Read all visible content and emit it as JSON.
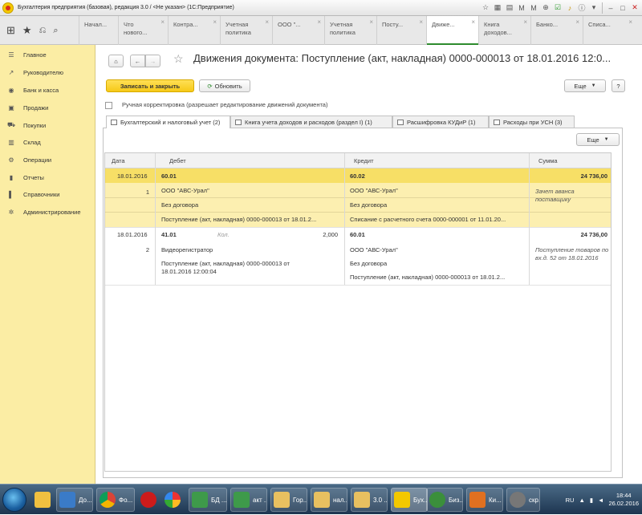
{
  "window": {
    "title": "Бухгалтерия предприятия (базовая), редакция 3.0 / <Не указан> (1С:Предприятие)"
  },
  "tabs": [
    {
      "label": "Начал..."
    },
    {
      "label": "Что нового..."
    },
    {
      "label": "Контра..."
    },
    {
      "label": "Учетная политика"
    },
    {
      "label": "ООО \"..."
    },
    {
      "label": "Учетная политика"
    },
    {
      "label": "Посту..."
    },
    {
      "label": "Движе..."
    },
    {
      "label": "Книга доходов..."
    },
    {
      "label": "Банко..."
    },
    {
      "label": "Списа..."
    }
  ],
  "sidebar": {
    "items": [
      {
        "label": "Главное",
        "icon": "menu-icon"
      },
      {
        "label": "Руководителю",
        "icon": "trend-icon"
      },
      {
        "label": "Банк и касса",
        "icon": "coins-icon"
      },
      {
        "label": "Продажи",
        "icon": "bag-icon"
      },
      {
        "label": "Покупки",
        "icon": "cart-icon"
      },
      {
        "label": "Склад",
        "icon": "warehouse-icon"
      },
      {
        "label": "Операции",
        "icon": "operations-icon"
      },
      {
        "label": "Отчеты",
        "icon": "chart-icon"
      },
      {
        "label": "Справочники",
        "icon": "book-icon"
      },
      {
        "label": "Администрирование",
        "icon": "gear-icon"
      }
    ]
  },
  "form": {
    "title": "Движения документа: Поступление (акт, накладная) 0000-000013 от 18.01.2016 12:0...",
    "save_close": "Записать и закрыть",
    "refresh": "Обновить",
    "more": "Еще",
    "help": "?",
    "manual_label": "Ручная корректировка (разрешает редактирование движений документа)",
    "tabs": [
      {
        "label": "Бухгалтерский и налоговый учет (2)"
      },
      {
        "label": "Книга учета доходов и расходов (раздел I) (1)"
      },
      {
        "label": "Расшифровка КУДиР (1)"
      },
      {
        "label": "Расходы при УСН (3)"
      }
    ],
    "table_more": "Еще"
  },
  "table": {
    "headers": {
      "date": "Дата",
      "debit": "Дебет",
      "credit": "Кредит",
      "sum": "Сумма"
    },
    "rows": [
      {
        "date": "18.01.2016",
        "num": "1",
        "debit_account": "60.01",
        "debit_1": "ООО \"АВС-Урал\"",
        "debit_2": "Без договора",
        "debit_3": "Поступление (акт, накладная) 0000-000013 от 18.01.2...",
        "credit_account": "60.02",
        "credit_1": "ООО \"АВС-Урал\"",
        "credit_2": "Без договора",
        "credit_3": "Списание с расчетного счета 0000-000001 от 11.01.20...",
        "sum": "24 736,00",
        "comment": "Зачет аванса поставщику"
      },
      {
        "date": "18.01.2016",
        "num": "2",
        "debit_account": "41.01",
        "qty_label": "Кол.",
        "qty": "2,000",
        "debit_1": "Видеорегистратор",
        "debit_2": "Поступление (акт, накладная) 0000-000013 от 18.01.2016 12:00:04",
        "credit_account": "60.01",
        "credit_1": "ООО \"АВС-Урал\"",
        "credit_2": "Без договора",
        "credit_3": "Поступление (акт, накладная) 0000-000013 от 18.01.2...",
        "sum": "24 736,00",
        "comment": "Поступление товаров по вх.д. 52 от 18.01.2016"
      }
    ]
  },
  "taskbar": {
    "buttons": [
      {
        "label": "",
        "icon": "mail-icon"
      },
      {
        "label": "До...",
        "icon": "document-icon"
      },
      {
        "label": "Фо...",
        "icon": "chrome-icon"
      },
      {
        "label": "",
        "icon": "opera-icon"
      },
      {
        "label": "",
        "icon": "paint-icon"
      },
      {
        "label": "БД ...",
        "icon": "database-icon"
      },
      {
        "label": "акт ...",
        "icon": "document-icon"
      },
      {
        "label": "Гор...",
        "icon": "folder-icon"
      },
      {
        "label": "нал...",
        "icon": "folder-icon"
      },
      {
        "label": "3.0 ...",
        "icon": "folder-icon"
      },
      {
        "label": "Бух...",
        "icon": "1c-icon"
      },
      {
        "label": "Биз...",
        "icon": "browser-icon"
      },
      {
        "label": "Ки...",
        "icon": "app-icon"
      },
      {
        "label": "скр...",
        "icon": "camera-icon"
      }
    ],
    "lang": "RU",
    "time": "18:44",
    "date": "26.02.2016"
  }
}
